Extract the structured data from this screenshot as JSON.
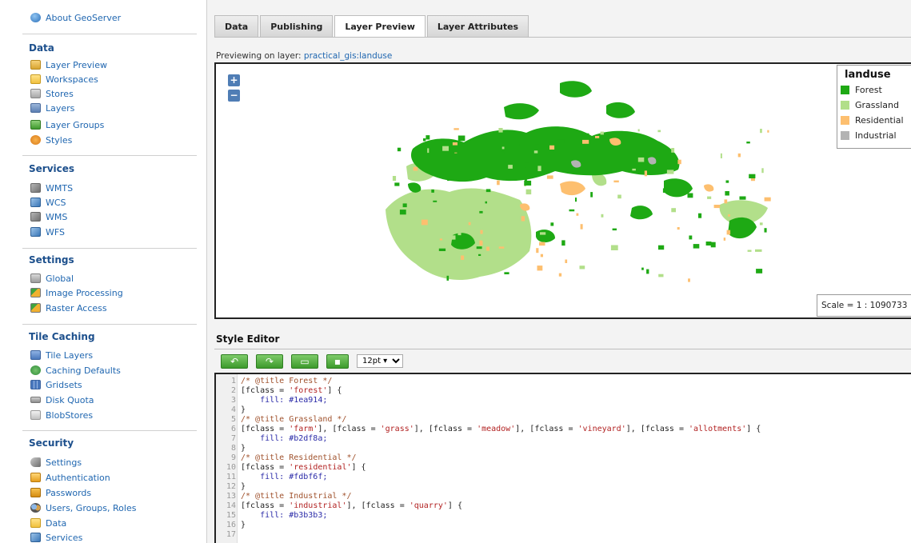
{
  "sidebar": {
    "about": "About GeoServer",
    "sections": {
      "data": "Data",
      "services": "Services",
      "settings": "Settings",
      "tile_caching": "Tile Caching",
      "security": "Security"
    },
    "data_items": [
      "Layer Preview",
      "Workspaces",
      "Stores",
      "Layers",
      "Layer Groups",
      "Styles"
    ],
    "services_items": [
      "WMTS",
      "WCS",
      "WMS",
      "WFS"
    ],
    "settings_items": [
      "Global",
      "Image Processing",
      "Raster Access"
    ],
    "tile_items": [
      "Tile Layers",
      "Caching Defaults",
      "Gridsets",
      "Disk Quota",
      "BlobStores"
    ],
    "security_items": [
      "Settings",
      "Authentication",
      "Passwords",
      "Users, Groups, Roles",
      "Data",
      "Services"
    ]
  },
  "tabs": [
    "Data",
    "Publishing",
    "Layer Preview",
    "Layer Attributes"
  ],
  "active_tab": "Layer Preview",
  "preview": {
    "prefix": "Previewing on layer: ",
    "layer": "practical_gis:landuse"
  },
  "map": {
    "zoom_in": "+",
    "zoom_out": "−",
    "legend": {
      "title": "landuse",
      "items": [
        {
          "label": "Forest",
          "color": "#1ea914"
        },
        {
          "label": "Grassland",
          "color": "#b2df8a"
        },
        {
          "label": "Residential",
          "color": "#fdbf6f"
        },
        {
          "label": "Industrial",
          "color": "#b3b3b3"
        }
      ]
    },
    "scale": "Scale = 1 : 1090733"
  },
  "style_editor": {
    "title": "Style Editor",
    "font_size": "12pt ▾",
    "lines": [
      {
        "n": "1",
        "t": "/* @title Forest */",
        "k": "com"
      },
      {
        "n": "2",
        "t": "[fclass = 'forest'] {",
        "k": "txt"
      },
      {
        "n": "3",
        "t": "    fill: #1ea914;",
        "k": "col"
      },
      {
        "n": "4",
        "t": "}",
        "k": "txt"
      },
      {
        "n": "5",
        "t": "/* @title Grassland */",
        "k": "com"
      },
      {
        "n": "6",
        "t": "[fclass = 'farm'], [fclass = 'grass'], [fclass = 'meadow'], [fclass = 'vineyard'], [fclass = 'allotments'] {",
        "k": "txt"
      },
      {
        "n": "7",
        "t": "    fill: #b2df8a;",
        "k": "col"
      },
      {
        "n": "8",
        "t": "}",
        "k": "txt"
      },
      {
        "n": "9",
        "t": "/* @title Residential */",
        "k": "com"
      },
      {
        "n": "10",
        "t": "[fclass = 'residential'] {",
        "k": "txt"
      },
      {
        "n": "11",
        "t": "    fill: #fdbf6f;",
        "k": "col"
      },
      {
        "n": "12",
        "t": "}",
        "k": "txt"
      },
      {
        "n": "13",
        "t": "/* @title Industrial */",
        "k": "com"
      },
      {
        "n": "14",
        "t": "[fclass = 'industrial'], [fclass = 'quarry'] {",
        "k": "txt"
      },
      {
        "n": "15",
        "t": "    fill: #b3b3b3;",
        "k": "col"
      },
      {
        "n": "16",
        "t": "}",
        "k": "txt"
      },
      {
        "n": "17",
        "t": "",
        "k": "txt"
      }
    ]
  },
  "icons": {
    "toolbar": [
      "undo-icon",
      "redo-icon",
      "image-icon",
      "save-icon"
    ]
  }
}
